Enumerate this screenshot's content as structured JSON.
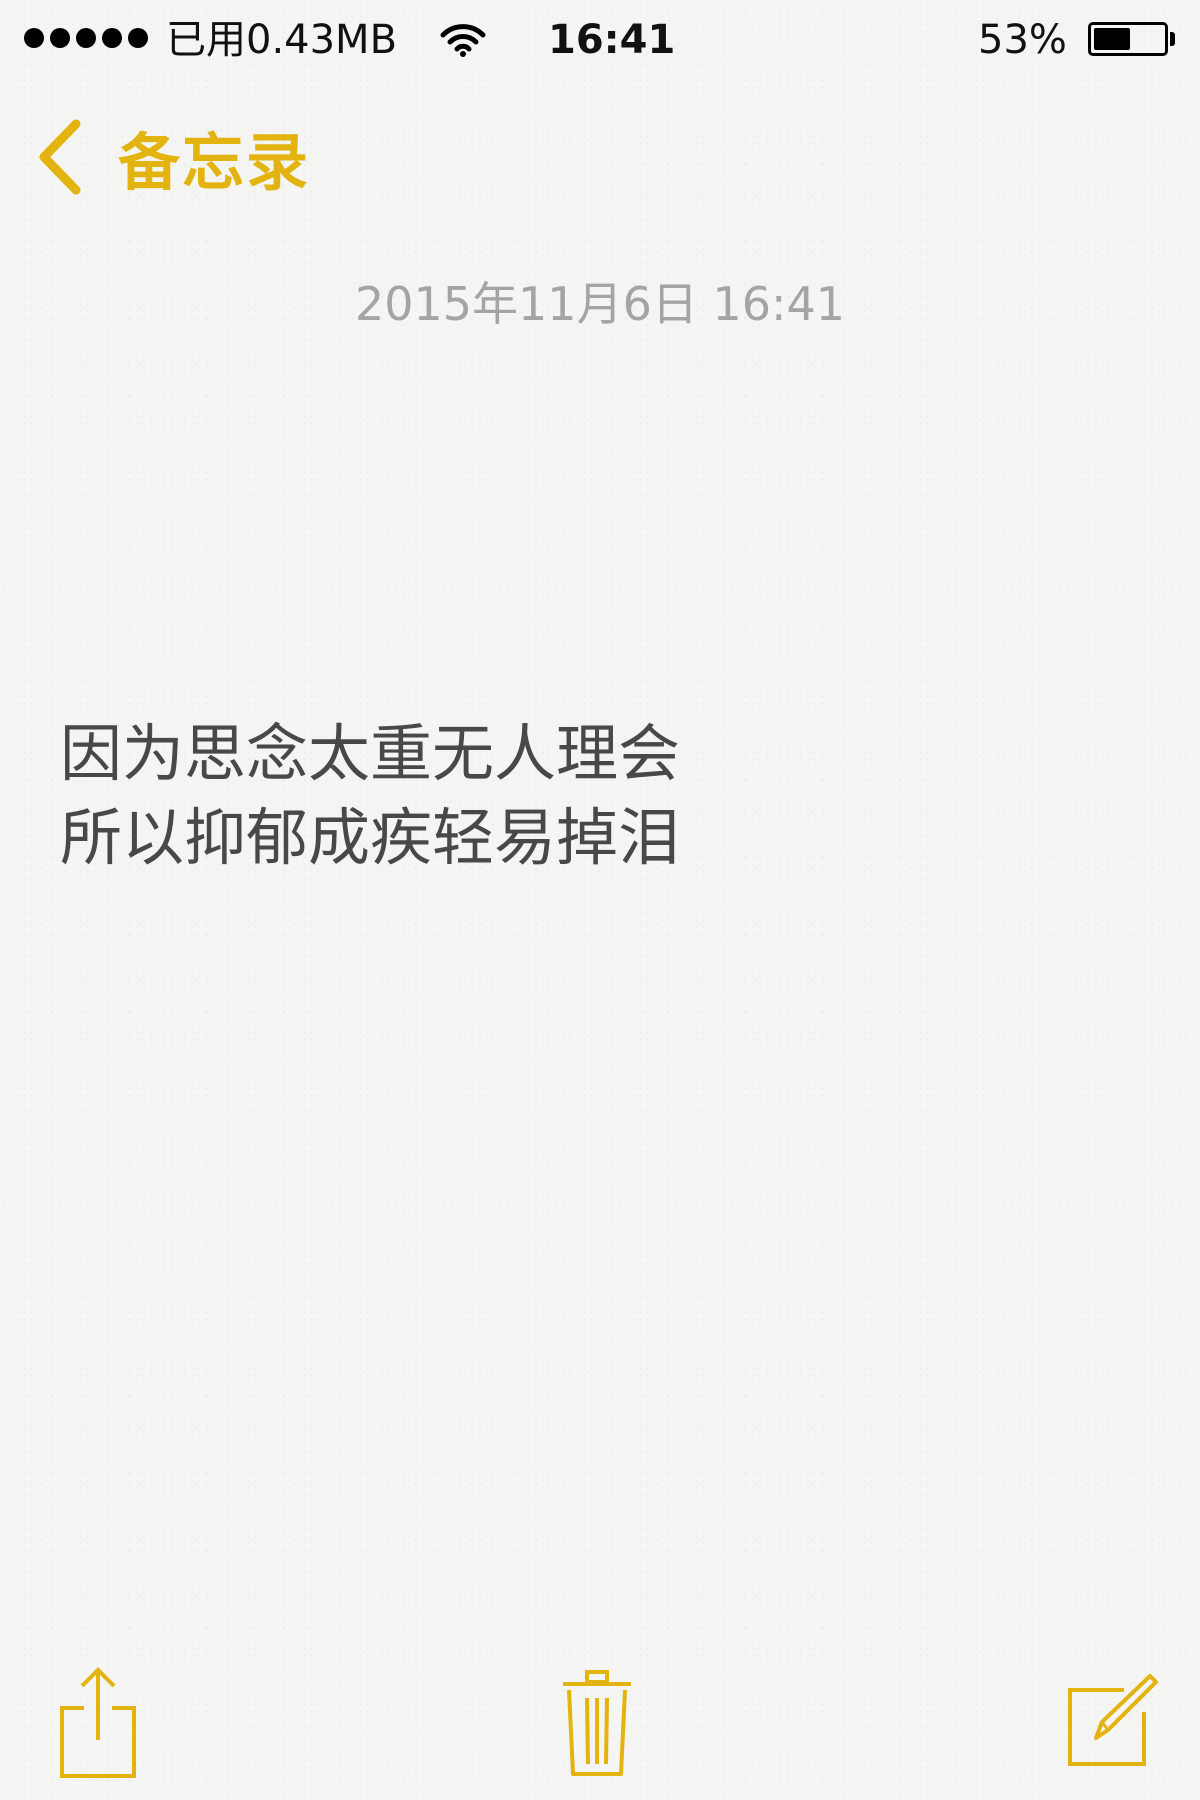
{
  "status_bar": {
    "carrier_text": "已用0.43MB",
    "time": "16:41",
    "battery_percent_text": "53%",
    "battery_level": 0.53,
    "signal_bars": 5,
    "signal_icon": "signal-dots-icon",
    "wifi_icon": "wifi-icon",
    "battery_icon": "battery-icon"
  },
  "nav": {
    "back_label": "备忘录",
    "back_icon": "chevron-left-icon"
  },
  "note": {
    "date": "2015年11月6日 16:41",
    "lines": [
      "因为思念太重无人理会",
      "所以抑郁成疾轻易掉泪"
    ]
  },
  "toolbar": {
    "share_icon": "share-icon",
    "trash_icon": "trash-icon",
    "compose_icon": "compose-icon"
  },
  "colors": {
    "accent": "#e3b30f",
    "background": "#f5f5f4",
    "body_text": "#484848",
    "date_text": "#a4a4a4"
  }
}
